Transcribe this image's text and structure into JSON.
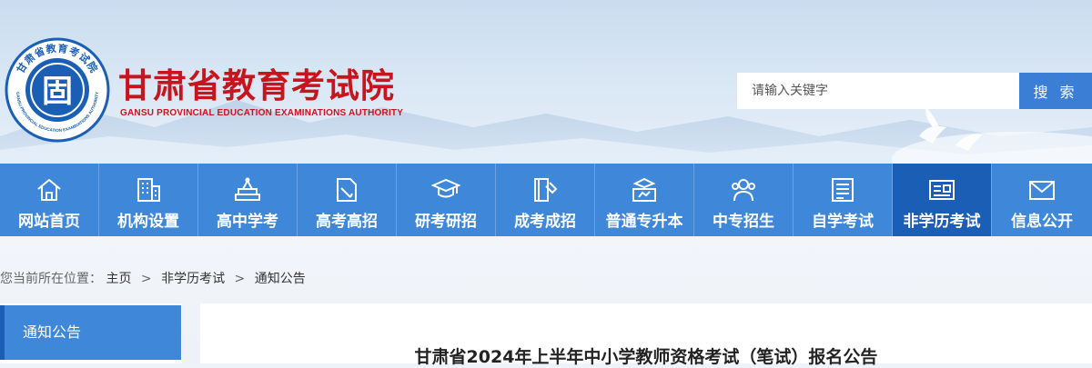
{
  "header": {
    "title": "甘肃省教育考试院",
    "subtitle": "GANSU PROVINCIAL EDUCATION EXAMINATIONS AUTHORITY",
    "logo": {
      "top_text": "甘肃省教育考试院",
      "bottom_text": "GANSU PROVINCIAL EDUCATION EXAMINATIONS AUTHORITY",
      "center_char": "固"
    }
  },
  "search": {
    "placeholder": "请输入关键字",
    "button_label": "搜 索"
  },
  "nav": {
    "items": [
      {
        "label": "网站首页",
        "icon": "home-icon"
      },
      {
        "label": "机构设置",
        "icon": "building-icon"
      },
      {
        "label": "高中学考",
        "icon": "books-icon"
      },
      {
        "label": "高考高招",
        "icon": "pen-document-icon"
      },
      {
        "label": "研考研招",
        "icon": "graduation-cap-icon"
      },
      {
        "label": "成考成招",
        "icon": "book-pencil-icon"
      },
      {
        "label": "普通专升本",
        "icon": "cap-screen-icon"
      },
      {
        "label": "中专招生",
        "icon": "people-icon"
      },
      {
        "label": "自学考试",
        "icon": "document-list-icon"
      },
      {
        "label": "非学历考试",
        "icon": "id-card-icon"
      },
      {
        "label": "信息公开",
        "icon": "mail-icon"
      }
    ],
    "active_index": 9
  },
  "breadcrumb": {
    "prefix": "您当前所在位置：",
    "items": [
      "主页",
      "非学历考试",
      "通知公告"
    ],
    "separator": ">"
  },
  "sidebar": {
    "items": [
      {
        "label": "通知公告"
      }
    ]
  },
  "article": {
    "title": "甘肃省2024年上半年中小学教师资格考试（笔试）报名公告"
  },
  "colors": {
    "brand_red": "#c8151d",
    "nav_blue": "#3e87d9",
    "nav_active": "#1a5fb5",
    "search_button": "#3a7fd5"
  }
}
